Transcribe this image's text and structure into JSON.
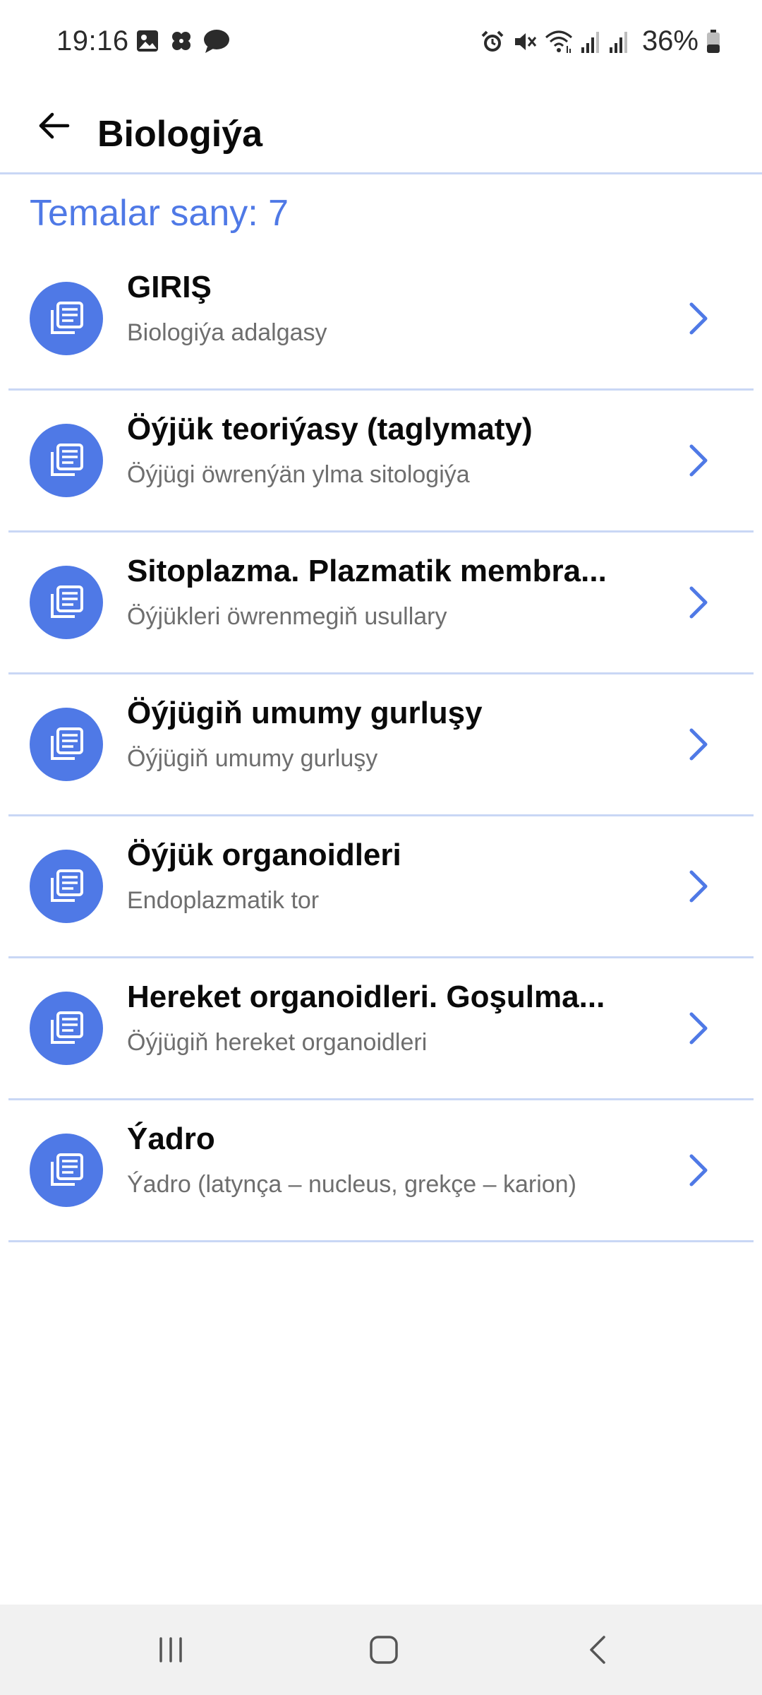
{
  "status_bar": {
    "time": "19:16",
    "battery_text": "36%",
    "left_icons": [
      "image-icon",
      "pinwheel-icon",
      "chat-bubble-icon"
    ],
    "right_icons": [
      "alarm-icon",
      "mute-icon",
      "wifi-icon",
      "signal-1-icon",
      "signal-2-icon",
      "battery-icon"
    ]
  },
  "app_bar": {
    "title": "Biologiýa",
    "back_icon": "arrow-left-icon"
  },
  "summary": {
    "count_text": "Temalar sany: 7"
  },
  "topics": [
    {
      "title": "GIRIŞ",
      "subtitle": "Biologiýa adalgasy"
    },
    {
      "title": "Öýjük teoriýasy (taglymaty)",
      "subtitle": "Öýjügi öwrenýän ylma sitologiýa"
    },
    {
      "title": "Sitoplazma. Plazmatik membra...",
      "subtitle": "Öýjükleri öwrenmegiň usullary"
    },
    {
      "title": "Öýjügiň umumy gurluşy",
      "subtitle": "Öýjügiň umumy gurluşy"
    },
    {
      "title": "Öýjük organoidleri",
      "subtitle": "Endoplazmatik tor"
    },
    {
      "title": "Hereket organoidleri. Goşulma...",
      "subtitle": "Öýjügiň hereket organoidleri"
    },
    {
      "title": "Ýadro",
      "subtitle": "Ýadro (latynça – nucleus, grekçe – karion)"
    }
  ],
  "colors": {
    "accent": "#4f79e6",
    "divider": "#c9d7f5",
    "title_text": "#0a0a0a",
    "subtitle_text": "#6e6e6e",
    "nav_bg": "#f1f1f1"
  },
  "nav_bar": {
    "buttons": [
      "recent-apps-icon",
      "home-icon",
      "back-icon"
    ]
  }
}
